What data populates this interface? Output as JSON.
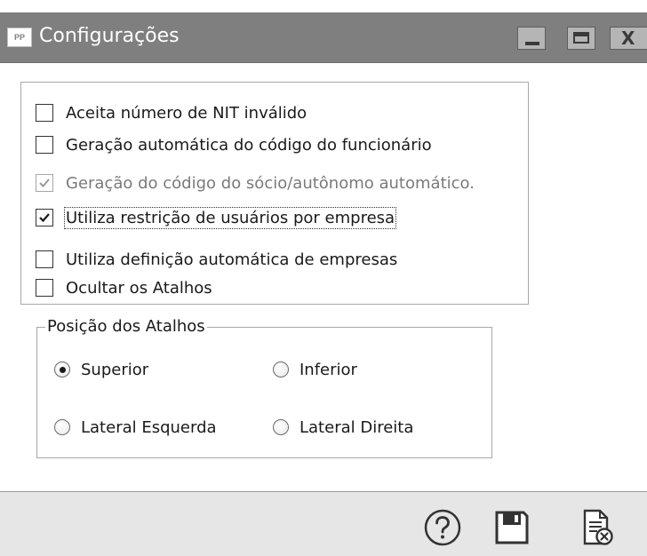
{
  "window": {
    "icon_text": "PP",
    "title": "Configurações"
  },
  "options": [
    {
      "label": "Aceita número de NIT inválido",
      "checked": false,
      "enabled": true
    },
    {
      "label": "Geração automática do código do funcionário",
      "checked": false,
      "enabled": true
    },
    {
      "label": "Geração do código do sócio/autônomo automático.",
      "checked": true,
      "enabled": false
    },
    {
      "label": "Utiliza restrição de usuários por empresa",
      "checked": true,
      "enabled": true,
      "focused": true
    },
    {
      "label": "Utiliza definição automática de empresas",
      "checked": false,
      "enabled": true
    },
    {
      "label": "Ocultar os Atalhos",
      "checked": false,
      "enabled": true
    }
  ],
  "shortcut_position": {
    "title": "Posição dos Atalhos",
    "options": [
      {
        "label": "Superior",
        "selected": true
      },
      {
        "label": "Inferior",
        "selected": false
      },
      {
        "label": "Lateral Esquerda",
        "selected": false
      },
      {
        "label": "Lateral Direita",
        "selected": false
      }
    ]
  },
  "footer": {
    "buttons": [
      {
        "name": "help",
        "icon": "question-circle-icon"
      },
      {
        "name": "save",
        "icon": "floppy-disk-icon"
      },
      {
        "name": "cancel",
        "icon": "document-cancel-icon"
      }
    ]
  }
}
